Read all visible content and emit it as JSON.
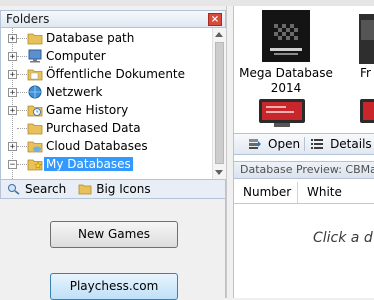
{
  "left_panel": {
    "title": "Folders",
    "close_label": "×",
    "tree": [
      {
        "label": "Database path",
        "expander": "+",
        "icon": "folder-icon"
      },
      {
        "label": "Computer",
        "expander": "+",
        "icon": "computer-icon"
      },
      {
        "label": "Öffentliche Dokumente",
        "expander": "+",
        "icon": "folder-icon"
      },
      {
        "label": "Netzwerk",
        "expander": "+",
        "icon": "network-icon"
      },
      {
        "label": "Game History",
        "expander": "+",
        "icon": "history-icon"
      },
      {
        "label": "Purchased Data",
        "expander": "",
        "icon": "folder-icon"
      },
      {
        "label": "Cloud Databases",
        "expander": "+",
        "icon": "cloud-folder-icon"
      },
      {
        "label": "My Databases",
        "expander": "−",
        "icon": "star-folder-icon",
        "selected": true
      }
    ],
    "toolbar": {
      "search_label": "Search",
      "big_icons_label": "Big Icons"
    },
    "buttons": {
      "new_games": "New Games",
      "playchess": "Playchess.com"
    }
  },
  "right_panel": {
    "databases": [
      {
        "label_line1": "Mega Database",
        "label_line2": "2014"
      },
      {
        "label_line1": "Fr",
        "label_line2": ""
      }
    ],
    "toolbar": {
      "open_label": "Open",
      "details_label": "Details"
    },
    "preview_title": "Database Preview: CBMain",
    "columns": [
      "Number",
      "White"
    ],
    "hint": "Click a d"
  },
  "colors": {
    "selection": "#3399ff",
    "close_button": "#d84a3c",
    "folder_yellow": "#e8c15a",
    "playchess_blue": "#bfe0f8"
  }
}
